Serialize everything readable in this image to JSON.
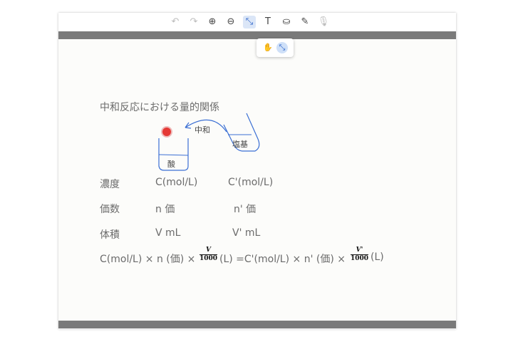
{
  "toolbar": {
    "icons": [
      {
        "name": "undo-icon",
        "glyph": "↶",
        "enabled": false
      },
      {
        "name": "redo-icon",
        "glyph": "↷",
        "enabled": false
      },
      {
        "name": "zoom-in-icon",
        "glyph": "⊕",
        "enabled": true
      },
      {
        "name": "zoom-out-icon",
        "glyph": "⊖",
        "enabled": true
      },
      {
        "name": "select-tool-icon",
        "glyph": "⤡",
        "enabled": true
      },
      {
        "name": "text-tool-icon",
        "glyph": "T",
        "enabled": true
      },
      {
        "name": "stamp-icon",
        "glyph": "⛀",
        "enabled": true
      },
      {
        "name": "pen-icon",
        "glyph": "✎",
        "enabled": true
      },
      {
        "name": "microphone-icon",
        "glyph": "🎙",
        "enabled": false
      }
    ]
  },
  "popup": {
    "icons": [
      {
        "name": "hand-tool-icon",
        "glyph": "✋"
      },
      {
        "name": "magic-select-icon",
        "glyph": "⤡"
      }
    ]
  },
  "colors": {
    "accent": "#2c63c9",
    "ink_blue": "#3b6fd4",
    "red_dot": "#e53935",
    "bar_gray": "#7a7a7a"
  },
  "slide": {
    "title": "中和反応における量的関係",
    "diagram": {
      "neutralization_label": "中和",
      "base_label": "塩基",
      "acid_label": "酸"
    },
    "rows": [
      {
        "label": "濃度",
        "a": "C(mol/L)",
        "b": "C'(mol/L)"
      },
      {
        "label": "価数",
        "a": "n 価",
        "b": "n' 価"
      },
      {
        "label": "体積",
        "a": "V mL",
        "b": "V' mL"
      }
    ],
    "formula": {
      "part1": "C(mol/L)  × n (価) ×",
      "frac1_num": "V",
      "frac1_den": "1000",
      "part2": "(L) =C'(mol/L)  × n' (価) ×",
      "frac2_num": "V'",
      "frac2_den": "1000",
      "part3": "(L)"
    }
  }
}
